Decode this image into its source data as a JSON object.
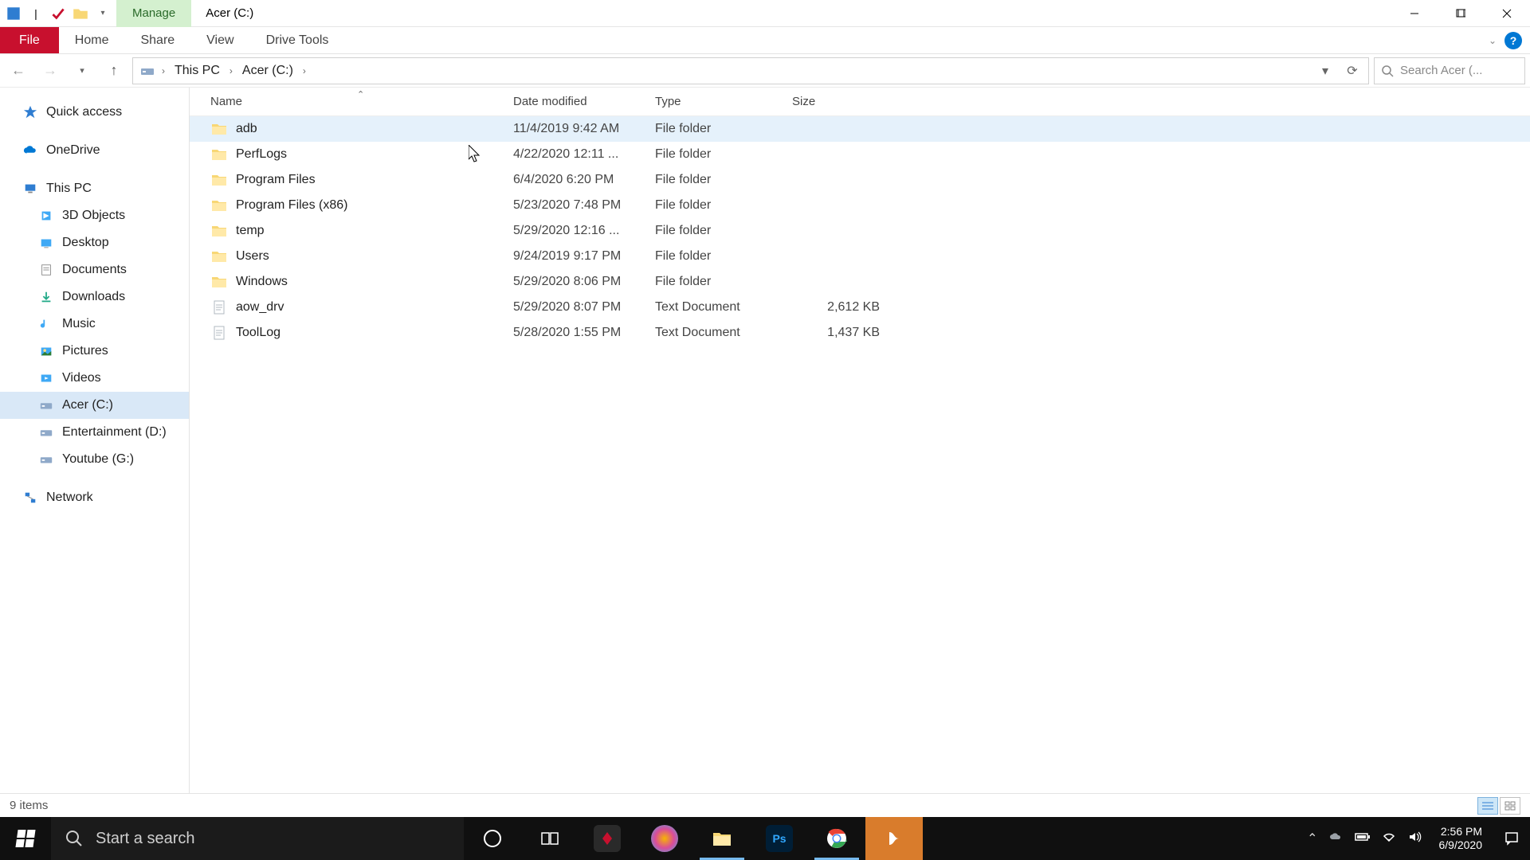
{
  "window": {
    "manage_tab": "Manage",
    "drive_tools": "Drive Tools",
    "title": "Acer (C:)"
  },
  "ribbon": {
    "file": "File",
    "home": "Home",
    "share": "Share",
    "view": "View"
  },
  "breadcrumb": {
    "this_pc": "This PC",
    "drive": "Acer (C:)"
  },
  "search": {
    "placeholder": "Search Acer (..."
  },
  "sidebar": {
    "quick_access": "Quick access",
    "onedrive": "OneDrive",
    "this_pc": "This PC",
    "items": [
      "3D Objects",
      "Desktop",
      "Documents",
      "Downloads",
      "Music",
      "Pictures",
      "Videos",
      "Acer (C:)",
      "Entertainment (D:)",
      "Youtube (G:)"
    ],
    "network": "Network"
  },
  "columns": {
    "name": "Name",
    "date": "Date modified",
    "type": "Type",
    "size": "Size"
  },
  "files": [
    {
      "name": "adb",
      "date": "11/4/2019 9:42 AM",
      "type": "File folder",
      "size": "",
      "kind": "folder",
      "hl": true
    },
    {
      "name": "PerfLogs",
      "date": "4/22/2020 12:11 ...",
      "type": "File folder",
      "size": "",
      "kind": "folder"
    },
    {
      "name": "Program Files",
      "date": "6/4/2020 6:20 PM",
      "type": "File folder",
      "size": "",
      "kind": "folder"
    },
    {
      "name": "Program Files (x86)",
      "date": "5/23/2020 7:48 PM",
      "type": "File folder",
      "size": "",
      "kind": "folder"
    },
    {
      "name": "temp",
      "date": "5/29/2020 12:16 ...",
      "type": "File folder",
      "size": "",
      "kind": "folder"
    },
    {
      "name": "Users",
      "date": "9/24/2019 9:17 PM",
      "type": "File folder",
      "size": "",
      "kind": "folder"
    },
    {
      "name": "Windows",
      "date": "5/29/2020 8:06 PM",
      "type": "File folder",
      "size": "",
      "kind": "folder"
    },
    {
      "name": "aow_drv",
      "date": "5/29/2020 8:07 PM",
      "type": "Text Document",
      "size": "2,612 KB",
      "kind": "text"
    },
    {
      "name": "ToolLog",
      "date": "5/28/2020 1:55 PM",
      "type": "Text Document",
      "size": "1,437 KB",
      "kind": "text"
    }
  ],
  "status": {
    "count": "9 items"
  },
  "taskbar": {
    "search_placeholder": "Start a search",
    "clock_time": "2:56 PM",
    "clock_date": "6/9/2020"
  }
}
